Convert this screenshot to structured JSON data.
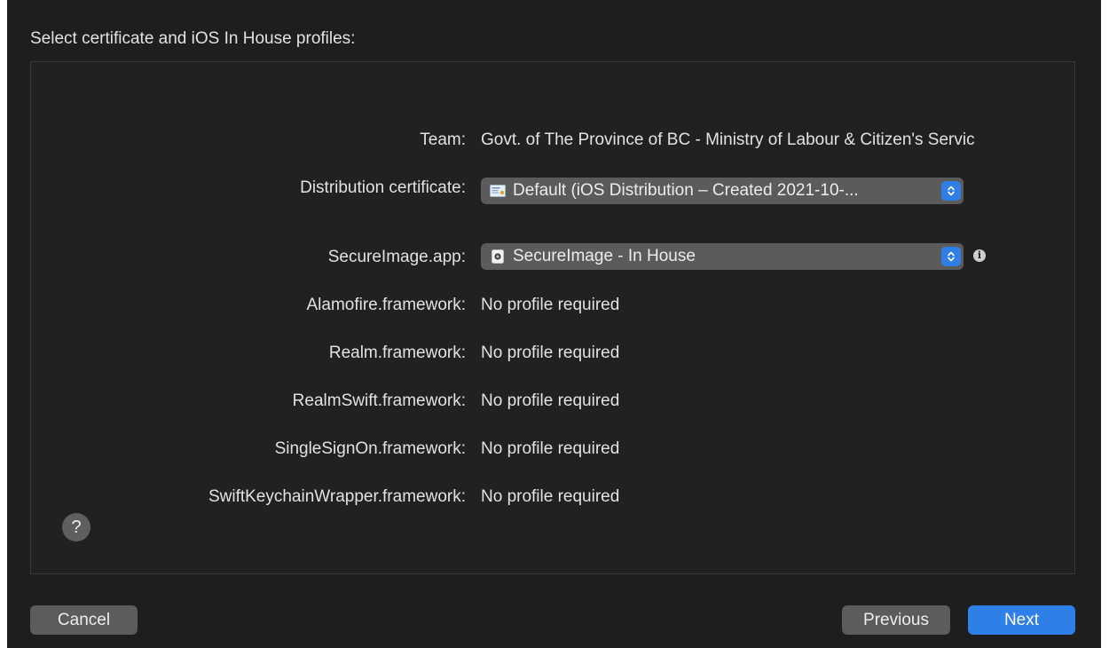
{
  "sheet": {
    "title": "Select certificate and iOS In House profiles:"
  },
  "form": {
    "team": {
      "label": "Team:",
      "value": "Govt. of The Province of BC - Ministry of Labour & Citizen's Servic"
    },
    "certificate": {
      "label": "Distribution certificate:",
      "selected": "Default (iOS Distribution – Created 2021-10-...",
      "icon": "certificate-icon"
    },
    "app": {
      "label": "SecureImage.app:",
      "selected": "SecureImage - In House",
      "icon": "provisioning-profile-icon",
      "info_icon": "info-icon"
    },
    "frameworks": [
      {
        "label": "Alamofire.framework:",
        "value": "No profile required"
      },
      {
        "label": "Realm.framework:",
        "value": "No profile required"
      },
      {
        "label": "RealmSwift.framework:",
        "value": "No profile required"
      },
      {
        "label": "SingleSignOn.framework:",
        "value": "No profile required"
      },
      {
        "label": "SwiftKeychainWrapper.framework:",
        "value": "No profile required"
      }
    ]
  },
  "help": {
    "glyph": "?"
  },
  "buttons": {
    "cancel": "Cancel",
    "previous": "Previous",
    "next": "Next"
  },
  "colors": {
    "accent": "#2f7fe8",
    "background": "#1e1e1e",
    "button": "#5c5c5c"
  }
}
